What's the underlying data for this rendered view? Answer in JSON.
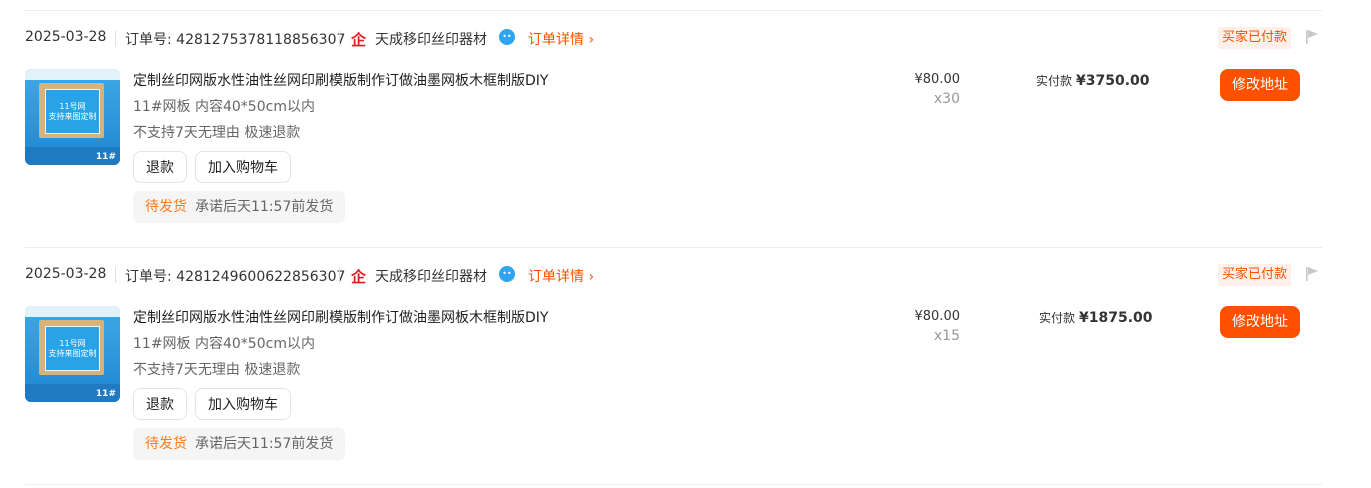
{
  "colors": {
    "accent": "#ff5000",
    "badge_bg": "#fdf0ea",
    "ship_status": "#ff7a1a"
  },
  "orders": [
    {
      "date": "2025-03-28",
      "order_no_label": "订单号: 4281275378118856307",
      "shop_icon": "企",
      "shop_name": "天成移印丝印器材",
      "detail_link": "订单详情 ›",
      "status_badge": "买家已付款",
      "product": {
        "title": "定制丝印网版水性油性丝网印刷模版制作订做油墨网板木框制版DIY",
        "spec": "11#网板 内容40*50cm以内",
        "service": "不支持7天无理由 极速退款",
        "thumb_text": "11号网\n支持来图定制",
        "thumb_tag": "11#"
      },
      "buttons": {
        "refund": "退款",
        "add_cart": "加入购物车",
        "change_address": "修改地址"
      },
      "shipping": {
        "status": "待发货",
        "promise": "承诺后天11:57前发货"
      },
      "unit_price": "¥80.00",
      "quantity": "x30",
      "paid_label": "实付款",
      "paid_amount": "¥3750.00"
    },
    {
      "date": "2025-03-28",
      "order_no_label": "订单号: 4281249600622856307",
      "shop_icon": "企",
      "shop_name": "天成移印丝印器材",
      "detail_link": "订单详情 ›",
      "status_badge": "买家已付款",
      "product": {
        "title": "定制丝印网版水性油性丝网印刷模版制作订做油墨网板木框制版DIY",
        "spec": "11#网板 内容40*50cm以内",
        "service": "不支持7天无理由 极速退款",
        "thumb_text": "11号网\n支持来图定制",
        "thumb_tag": "11#"
      },
      "buttons": {
        "refund": "退款",
        "add_cart": "加入购物车",
        "change_address": "修改地址"
      },
      "shipping": {
        "status": "待发货",
        "promise": "承诺后天11:57前发货"
      },
      "unit_price": "¥80.00",
      "quantity": "x15",
      "paid_label": "实付款",
      "paid_amount": "¥1875.00"
    }
  ]
}
